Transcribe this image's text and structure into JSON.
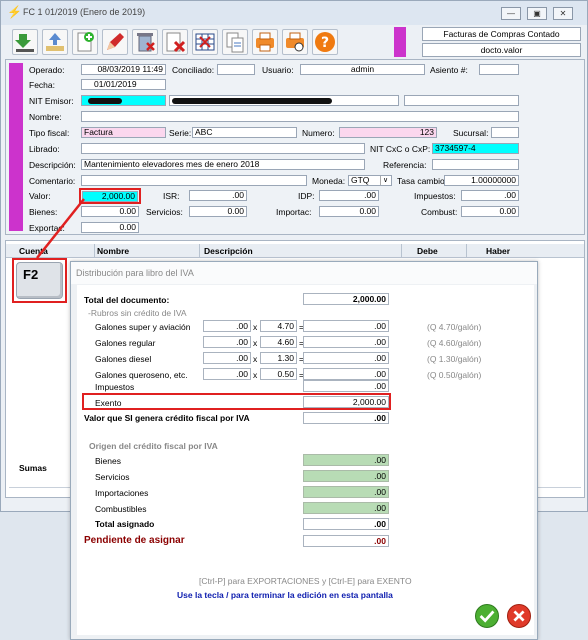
{
  "window": {
    "title": "FC 1 01/2019 (Enero de 2019)",
    "min": "—",
    "max": "▣",
    "close": "✕"
  },
  "header_right": {
    "doc_type": "Facturas de Compras Contado",
    "doc_value": "docto.valor"
  },
  "form": {
    "operado_label": "Operado:",
    "operado": "08/03/2019 11:49",
    "conciliado_label": "Conciliado:",
    "conciliado": "",
    "usuario_label": "Usuario:",
    "usuario": "admin",
    "asiento_label": "Asiento #:",
    "asiento": "",
    "fecha_label": "Fecha:",
    "fecha": "01/01/2019",
    "nit_label": "NIT Emisor:",
    "nombre_label": "Nombre:",
    "tipo_label": "Tipo fiscal:",
    "tipo": "Factura",
    "serie_label": "Serie:",
    "serie": "ABC",
    "numero_label": "Numero:",
    "numero": "123",
    "sucursal_label": "Sucursal:",
    "sucursal": "",
    "librado_label": "Librado:",
    "nitcxc_label": "NIT CxC o CxP:",
    "nitcxc": "3734597-4",
    "descripcion_label": "Descripción:",
    "descripcion": "Mantenimiento elevadores mes de enero 2018",
    "referencia_label": "Referencia:",
    "referencia": "",
    "comentario_label": "Comentario:",
    "comentario": "",
    "moneda_label": "Moneda:",
    "moneda": "GTQ",
    "tasa_label": "Tasa cambio:",
    "tasa": "1.00000000",
    "valor_label": "Valor:",
    "valor": "2,000.00",
    "isr_label": "ISR:",
    "isr": ".00",
    "idp_label": "IDP:",
    "idp": ".00",
    "impuestos_label": "Impuestos:",
    "impuestos": ".00",
    "bienes_label": "Bienes:",
    "bienes": "0.00",
    "servicios_label": "Servicios:",
    "servicios": "0.00",
    "importac_label": "Importac:",
    "importac": "0.00",
    "combust_label": "Combust:",
    "combust": "0.00",
    "exportac_label": "Exportac:",
    "exportac": "0.00"
  },
  "grid": {
    "cuenta": "Cuenta",
    "nombre": "Nombre",
    "descripcion": "Descripción",
    "debe": "Debe",
    "haber": "Haber",
    "sumas": "Sumas"
  },
  "key_hint": "F2",
  "dialog": {
    "title": "Distribución para libro del IVA",
    "total_label": "Total del documento:",
    "total": "2,000.00",
    "rubros_label": "-Rubros sin crédito de IVA",
    "rows": [
      {
        "label": "Galones super y aviación",
        "qty": ".00",
        "x": "x",
        "price": "4.70",
        "eq": "=",
        "amount": ".00",
        "note": "(Q 4.70/galón)"
      },
      {
        "label": "Galones regular",
        "qty": ".00",
        "x": "x",
        "price": "4.60",
        "eq": "=",
        "amount": ".00",
        "note": "(Q 4.60/galón)"
      },
      {
        "label": "Galones diesel",
        "qty": ".00",
        "x": "x",
        "price": "1.30",
        "eq": "=",
        "amount": ".00",
        "note": "(Q 1.30/galón)"
      },
      {
        "label": "Galones queroseno, etc.",
        "qty": ".00",
        "x": "x",
        "price": "0.50",
        "eq": "=",
        "amount": ".00",
        "note": "(Q 0.50/galón)"
      }
    ],
    "impuestos_label": "Impuestos",
    "impuestos": ".00",
    "exento_label": "Exento",
    "exento": "2,000.00",
    "valor_si_label": "Valor que SI genera crédito fiscal por IVA",
    "valor_si": ".00",
    "origen_label": "Origen del crédito fiscal por IVA",
    "bienes_label": "Bienes",
    "bienes": ".00",
    "servicios_label": "Servicios",
    "servicios": ".00",
    "importaciones_label": "Importaciones",
    "importaciones": ".00",
    "combustibles_label": "Combustibles",
    "combustibles": ".00",
    "total_asignado_label": "Total asignado",
    "total_asignado": ".00",
    "pendiente_label": "Pendiente de asignar",
    "pendiente": ".00",
    "hint1": "[Ctrl-P] para EXPORTACIONES y [Ctrl-E] para EXENTO",
    "hint2": "Use la tecla / para terminar la edición en esta pantalla"
  },
  "colors": {
    "accent_magenta": "#cc33cc",
    "highlight_red": "#e02020",
    "cyan": "#00ffff",
    "pink": "#fbd7ee",
    "green": "#b8dcb5",
    "pendiente": "#8b0000",
    "hint_blue": "#1020b0"
  }
}
